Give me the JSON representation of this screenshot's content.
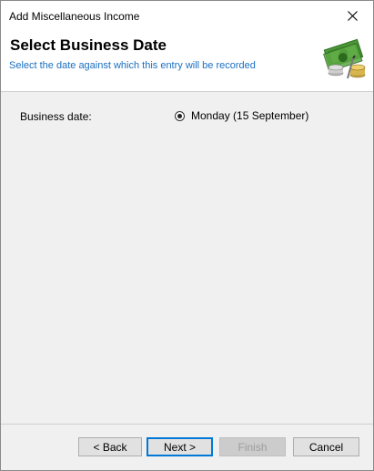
{
  "window": {
    "title": "Add Miscellaneous Income"
  },
  "header": {
    "title": "Select Business Date",
    "subtitle": "Select the date against which this entry will be recorded",
    "icon": "money-icon"
  },
  "form": {
    "business_date_label": "Business date:",
    "option_label": "Monday (15 September)",
    "option_selected": true
  },
  "buttons": {
    "back": "< Back",
    "next": "Next >",
    "finish": "Finish",
    "cancel": "Cancel"
  },
  "colors": {
    "subtitle": "#1a6fc2",
    "default_button_border": "#0078d7"
  }
}
